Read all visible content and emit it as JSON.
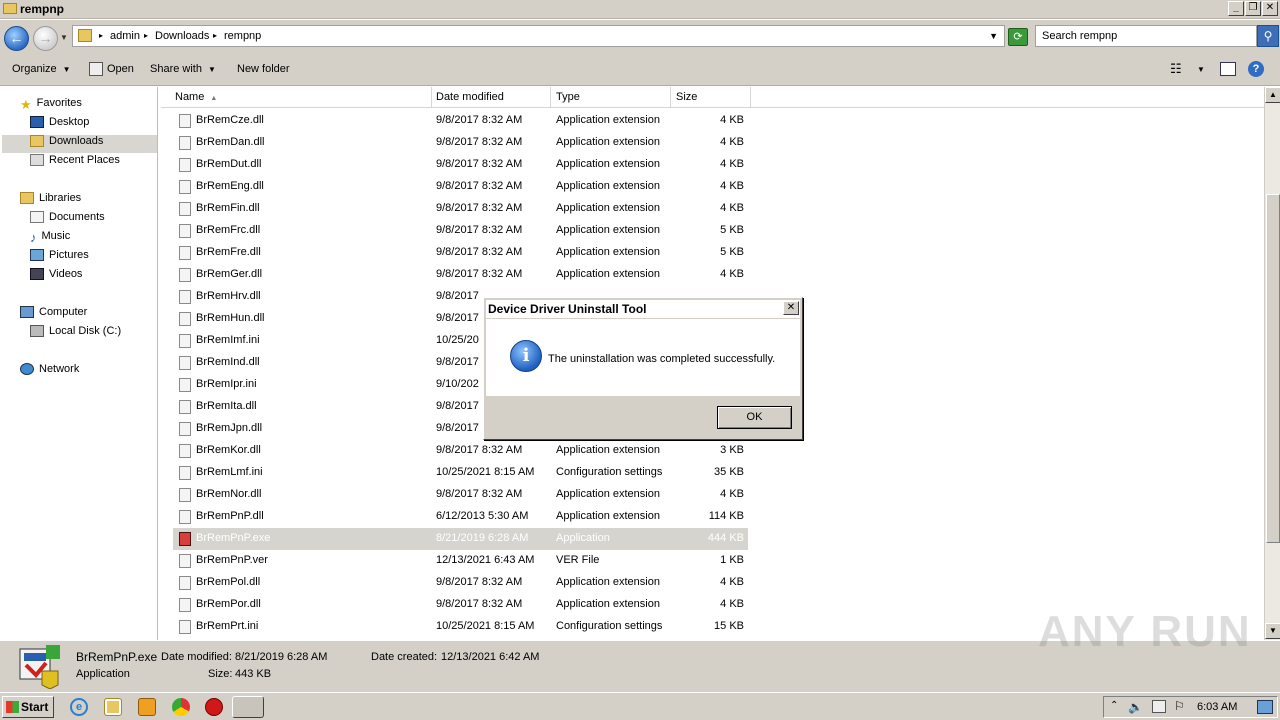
{
  "window": {
    "title": "rempnp"
  },
  "address": {
    "crumbs": [
      "admin",
      "Downloads",
      "rempnp"
    ]
  },
  "search": {
    "placeholder": "Search rempnp"
  },
  "toolbar": {
    "organize": "Organize",
    "open": "Open",
    "share_with": "Share with",
    "new_folder": "New folder"
  },
  "nav": {
    "favorites": "Favorites",
    "desktop": "Desktop",
    "downloads": "Downloads",
    "recent": "Recent Places",
    "libraries": "Libraries",
    "documents": "Documents",
    "music": "Music",
    "pictures": "Pictures",
    "videos": "Videos",
    "computer": "Computer",
    "local_disk": "Local Disk (C:)",
    "network": "Network"
  },
  "columns": {
    "name": "Name",
    "date": "Date modified",
    "type": "Type",
    "size": "Size"
  },
  "files": [
    {
      "name": "BrRemCze.dll",
      "date": "9/8/2017 8:32 AM",
      "type": "Application extension",
      "size": "4 KB"
    },
    {
      "name": "BrRemDan.dll",
      "date": "9/8/2017 8:32 AM",
      "type": "Application extension",
      "size": "4 KB"
    },
    {
      "name": "BrRemDut.dll",
      "date": "9/8/2017 8:32 AM",
      "type": "Application extension",
      "size": "4 KB"
    },
    {
      "name": "BrRemEng.dll",
      "date": "9/8/2017 8:32 AM",
      "type": "Application extension",
      "size": "4 KB"
    },
    {
      "name": "BrRemFin.dll",
      "date": "9/8/2017 8:32 AM",
      "type": "Application extension",
      "size": "4 KB"
    },
    {
      "name": "BrRemFrc.dll",
      "date": "9/8/2017 8:32 AM",
      "type": "Application extension",
      "size": "5 KB"
    },
    {
      "name": "BrRemFre.dll",
      "date": "9/8/2017 8:32 AM",
      "type": "Application extension",
      "size": "5 KB"
    },
    {
      "name": "BrRemGer.dll",
      "date": "9/8/2017 8:32 AM",
      "type": "Application extension",
      "size": "4 KB"
    },
    {
      "name": "BrRemHrv.dll",
      "date": "9/8/2017",
      "type": "",
      "size": ""
    },
    {
      "name": "BrRemHun.dll",
      "date": "9/8/2017",
      "type": "",
      "size": ""
    },
    {
      "name": "BrRemImf.ini",
      "date": "10/25/20",
      "type": "",
      "size": ""
    },
    {
      "name": "BrRemInd.dll",
      "date": "9/8/2017",
      "type": "",
      "size": ""
    },
    {
      "name": "BrRemIpr.ini",
      "date": "9/10/202",
      "type": "",
      "size": ""
    },
    {
      "name": "BrRemIta.dll",
      "date": "9/8/2017",
      "type": "",
      "size": ""
    },
    {
      "name": "BrRemJpn.dll",
      "date": "9/8/2017",
      "type": "",
      "size": ""
    },
    {
      "name": "BrRemKor.dll",
      "date": "9/8/2017 8:32 AM",
      "type": "Application extension",
      "size": "3 KB"
    },
    {
      "name": "BrRemLmf.ini",
      "date": "10/25/2021 8:15 AM",
      "type": "Configuration settings",
      "size": "35 KB"
    },
    {
      "name": "BrRemNor.dll",
      "date": "9/8/2017 8:32 AM",
      "type": "Application extension",
      "size": "4 KB"
    },
    {
      "name": "BrRemPnP.dll",
      "date": "6/12/2013 5:30 AM",
      "type": "Application extension",
      "size": "114 KB"
    },
    {
      "name": "BrRemPnP.exe",
      "date": "8/21/2019 6:28 AM",
      "type": "Application",
      "size": "444 KB",
      "selected": true
    },
    {
      "name": "BrRemPnP.ver",
      "date": "12/13/2021 6:43 AM",
      "type": "VER File",
      "size": "1 KB"
    },
    {
      "name": "BrRemPol.dll",
      "date": "9/8/2017 8:32 AM",
      "type": "Application extension",
      "size": "4 KB"
    },
    {
      "name": "BrRemPor.dll",
      "date": "9/8/2017 8:32 AM",
      "type": "Application extension",
      "size": "4 KB"
    },
    {
      "name": "BrRemPrt.ini",
      "date": "10/25/2021 8:15 AM",
      "type": "Configuration settings",
      "size": "15 KB"
    }
  ],
  "details": {
    "name": "BrRemPnP.exe",
    "type": "Application",
    "modified_label": "Date modified:",
    "modified": "8/21/2019 6:28 AM",
    "size_label": "Size:",
    "size": "443 KB",
    "created_label": "Date created:",
    "created": "12/13/2021 6:42 AM"
  },
  "dialog": {
    "title": "Device Driver Uninstall Tool",
    "message": "The uninstallation was completed successfully.",
    "ok": "OK"
  },
  "taskbar": {
    "start": "Start",
    "clock": "6:03 AM"
  },
  "watermark": "ANY RUN"
}
